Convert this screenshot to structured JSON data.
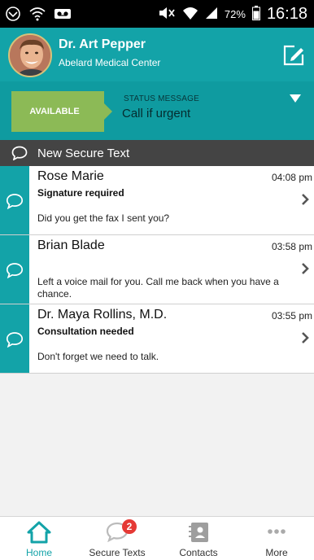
{
  "statusbar": {
    "battery_percent": "72%",
    "time": "16:18"
  },
  "header": {
    "doctor_name": "Dr. Art Pepper",
    "center": "Abelard Medical Center"
  },
  "status": {
    "availability": "AVAILABLE",
    "label": "STATUS MESSAGE",
    "message": "Call if urgent"
  },
  "new_text": {
    "label": "New Secure Text"
  },
  "messages": [
    {
      "sender": "Rose Marie",
      "time": "04:08 pm",
      "subject": "Signature required",
      "preview": "Did you get the fax I sent you?"
    },
    {
      "sender": "Brian Blade",
      "time": "03:58 pm",
      "subject": "",
      "preview": "Left a voice mail for you. Call me back when you have a chance."
    },
    {
      "sender": "Dr. Maya Rollins, M.D.",
      "time": "03:55 pm",
      "subject": "Consultation needed",
      "preview": "Don't forget we need to talk."
    }
  ],
  "nav": {
    "home": "Home",
    "secure_texts": "Secure Texts",
    "secure_texts_badge": "2",
    "contacts": "Contacts",
    "more": "More"
  },
  "colors": {
    "teal": "#13a3a8",
    "available_green": "#8cba56",
    "dark_bar": "#444444",
    "badge_red": "#e53935"
  }
}
